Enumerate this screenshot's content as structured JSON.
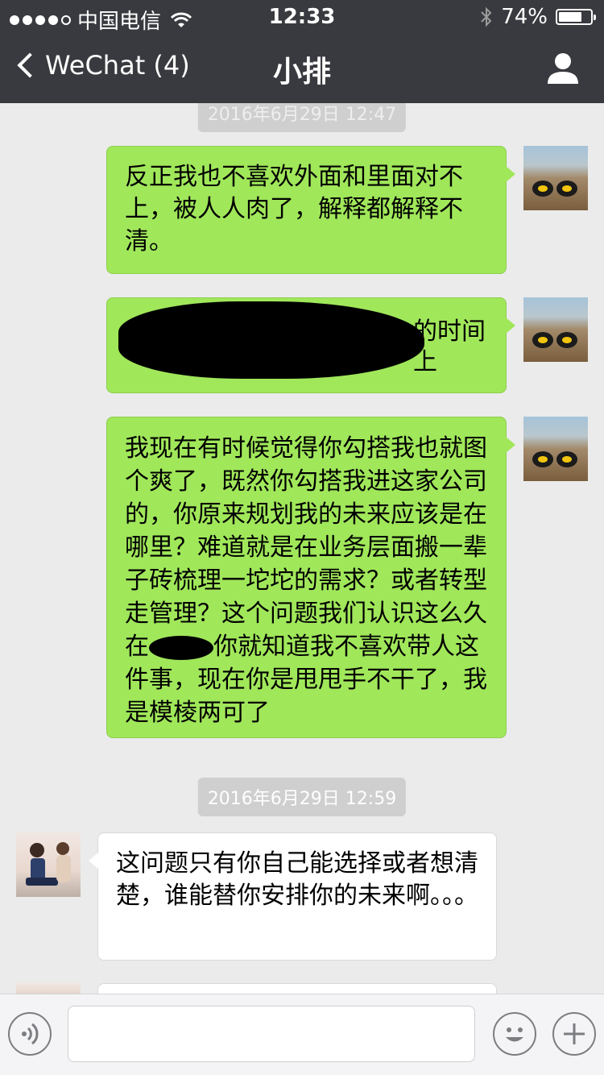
{
  "status_bar": {
    "carrier": "中国电信",
    "time": "12:33",
    "battery": "74%",
    "battery_level": 0.74,
    "signal_dots_filled": 4,
    "signal_dots_total": 5,
    "icons": [
      "wifi-icon",
      "bluetooth-icon",
      "battery-icon"
    ]
  },
  "nav": {
    "back_label": "WeChat (4)",
    "title": "小排",
    "right_icon": "person-icon"
  },
  "chat": {
    "timestamps": [
      "2016年6月29日 12:47",
      "2016年6月29日 12:59"
    ],
    "messages": [
      {
        "side": "outgoing",
        "text": "反正我也不喜欢外面和里面对不上，被人人肉了，解释都解释不清。"
      },
      {
        "side": "outgoing",
        "text": "的时间",
        "text2": "上",
        "redacted": true
      },
      {
        "side": "outgoing",
        "text": "我现在有时候觉得你勾搭我也就图个爽了，既然你勾搭我进这家公司的，你原来规划我的未来应该是在哪里？难道就是在业务层面搬一辈子砖梳理一坨坨的需求？或者转型走管理？这个问题我们认识这么久在",
        "text_after_redaction": "你就知道我不喜欢带人这件事，现在你是甩甩手不干了，我是模棱两可了"
      },
      {
        "side": "incoming",
        "text": "这问题只有你自己能选择或者想清楚，谁能替你安排你的未来啊。。。"
      }
    ]
  },
  "input_bar": {
    "placeholder": "",
    "icons": [
      "voice-icon",
      "emoji-icon",
      "plus-icon"
    ]
  },
  "colors": {
    "header_bg": "#393a3f",
    "chat_bg": "#ebebeb",
    "outgoing_bubble": "#a0e75a",
    "incoming_bubble": "#ffffff",
    "timestamp_bg": "#cfcfcf"
  }
}
